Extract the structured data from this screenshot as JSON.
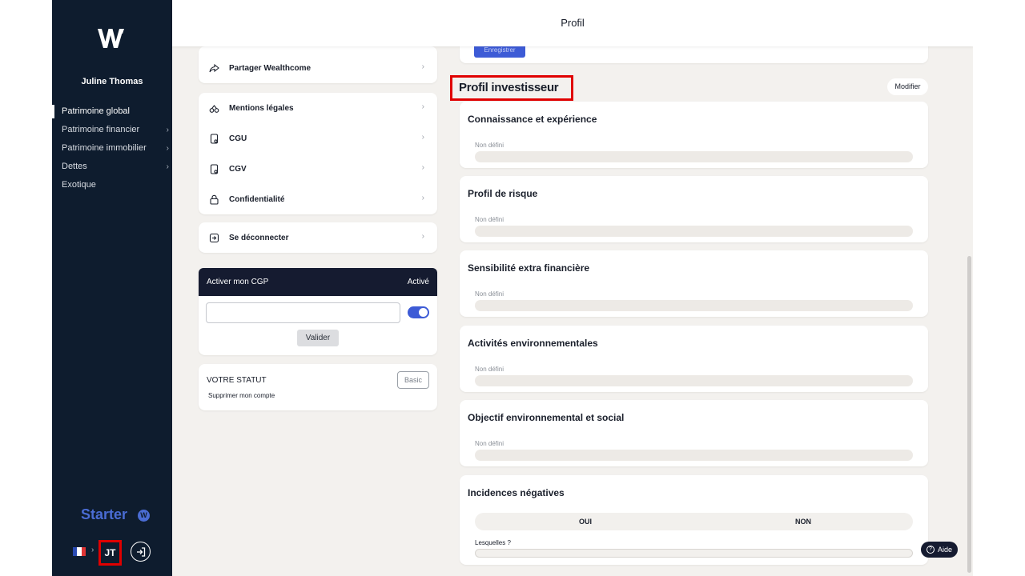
{
  "sidebar": {
    "user_name": "Juline Thomas",
    "nav": [
      {
        "label": "Patrimoine global",
        "active": true,
        "has_chevron": false
      },
      {
        "label": "Patrimoine financier",
        "active": false,
        "has_chevron": true
      },
      {
        "label": "Patrimoine immobilier",
        "active": false,
        "has_chevron": true
      },
      {
        "label": "Dettes",
        "active": false,
        "has_chevron": true
      },
      {
        "label": "Exotique",
        "active": false,
        "has_chevron": false
      }
    ],
    "plan_label": "Starter",
    "plan_badge": "W",
    "user_initials": "JT",
    "language_flag": "flag-france-icon"
  },
  "topbar": {
    "title": "Profil"
  },
  "left_menu": {
    "share_label": "Partager Wealthcome",
    "legal_items": [
      {
        "label": "Mentions légales",
        "icon": "scale-icon"
      },
      {
        "label": "CGU",
        "icon": "document-icon"
      },
      {
        "label": "CGV",
        "icon": "document-icon"
      },
      {
        "label": "Confidentialité",
        "icon": "lock-icon"
      }
    ],
    "logout_label": "Se déconnecter"
  },
  "cgp": {
    "title": "Activer mon CGP",
    "status": "Activé",
    "input_value": "",
    "toggle_on": true,
    "validate_label": "Valider"
  },
  "statut": {
    "title": "VOTRE STATUT",
    "badge": "Basic",
    "delete_label": "Supprimer mon compte"
  },
  "save_button_label": "Enregistrer",
  "investor": {
    "title": "Profil investisseur",
    "edit_label": "Modifier",
    "questions": [
      {
        "title": "Connaissance et expérience",
        "value": "Non défini"
      },
      {
        "title": "Profil de risque",
        "value": "Non défini"
      },
      {
        "title": "Sensibilité extra financière",
        "value": "Non défini"
      },
      {
        "title": "Activités environnementales",
        "value": "Non défini"
      },
      {
        "title": "Objectif environnemental et social",
        "value": "Non défini"
      }
    ],
    "negative": {
      "title": "Incidences négatives",
      "yes_label": "OUI",
      "no_label": "NON",
      "which_label": "Lesquelles ?"
    }
  },
  "help_label": "Aide",
  "colors": {
    "sidebar_bg": "#0e1c2e",
    "accent": "#3d5bd6",
    "highlight": "#e00000"
  }
}
